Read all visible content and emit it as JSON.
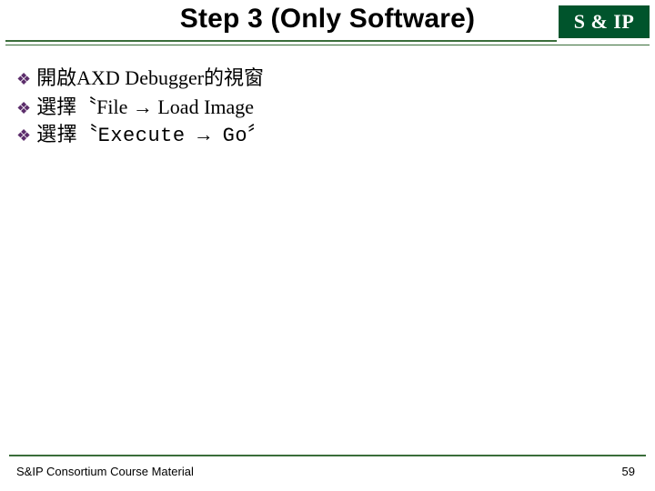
{
  "header": {
    "title": "Step 3 (Only Software)",
    "logo_text": "S & IP"
  },
  "bullets": [
    {
      "text": "開啟AXD Debugger的視窗",
      "style": "serif"
    },
    {
      "text": "選擇〝File → Load Image",
      "style": "serif"
    },
    {
      "text": "選擇〝Execute → Go〞",
      "style": "mono"
    }
  ],
  "footer": {
    "left": "S&IP Consortium Course Material",
    "page": "59"
  },
  "glyphs": {
    "bullet": "❖"
  }
}
